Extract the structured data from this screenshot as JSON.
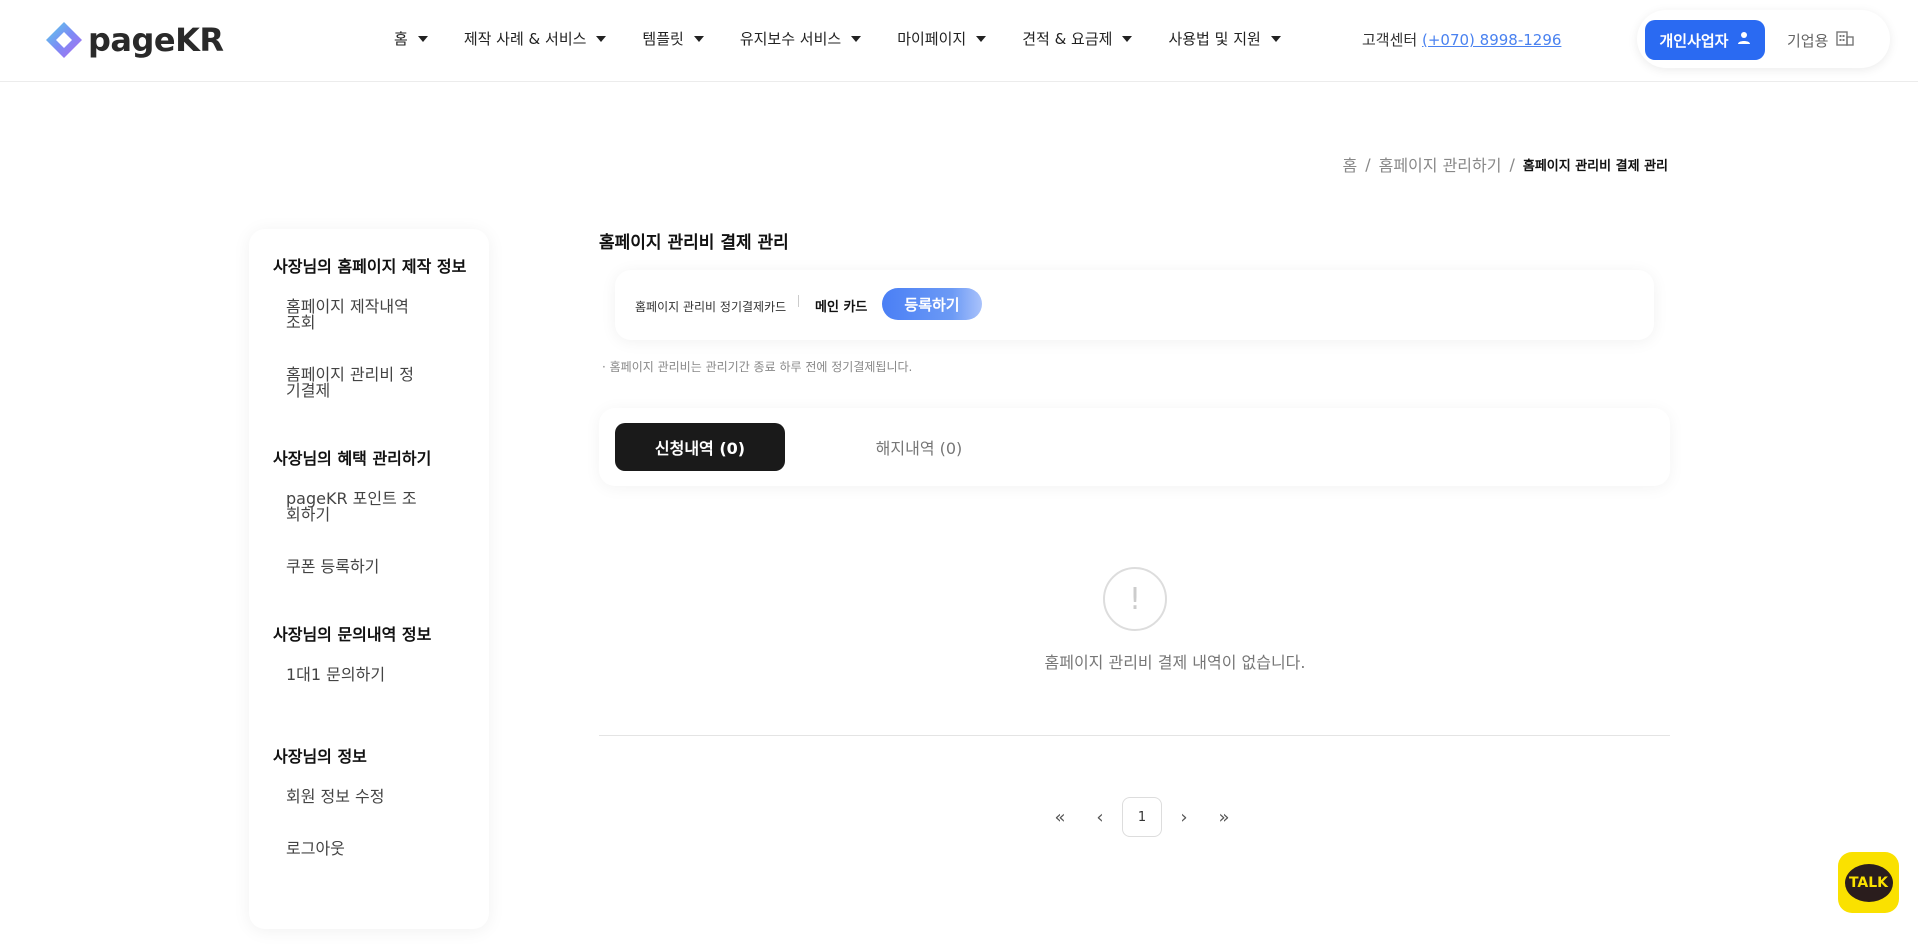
{
  "header": {
    "logo_text": "pageKR",
    "nav": [
      {
        "label": "홈"
      },
      {
        "label": "제작 사례 & 서비스"
      },
      {
        "label": "템플릿"
      },
      {
        "label": "유지보수 서비스"
      },
      {
        "label": "마이페이지"
      },
      {
        "label": "견적 & 요금제"
      },
      {
        "label": "사용법 및 지원"
      }
    ],
    "cs_label": "고객센터",
    "cs_phone": "(+070) 8998-1296",
    "personal_label": "개인사업자",
    "corp_label": "기업용",
    "accent_color": "#2a6af2"
  },
  "breadcrumb": {
    "home": "홈",
    "parent": "홈페이지 관리하기",
    "current": "홈페이지 관리비 결제 관리"
  },
  "sidebar": {
    "groups": [
      {
        "title": "사장님의 홈페이지 제작 정보",
        "items": [
          "홈페이지 제작내역 조회",
          "홈페이지 관리비 정기결제"
        ]
      },
      {
        "title": "사장님의 혜택 관리하기",
        "items": [
          "pageKR 포인트 조회하기",
          "쿠폰 등록하기"
        ]
      },
      {
        "title": "사장님의 문의내역 정보",
        "items": [
          "1대1 문의하기"
        ]
      },
      {
        "title": "사장님의 정보",
        "items": [
          "회원 정보 수정",
          "로그아웃"
        ]
      }
    ]
  },
  "main": {
    "title": "홈페이지 관리비 결제 관리",
    "card_label": "홈페이지 관리비 정기결제카드",
    "card_main_label": "메인 카드",
    "register_label": "등록하기",
    "note": "· 홈페이지 관리비는 관리기간 종료 하루 전에 정기결제됩니다.",
    "tab_active": "신청내역 (0)",
    "tab_inactive": "해지내역 (0)",
    "empty_text": "홈페이지 관리비 결제 내역이 없습니다.",
    "current_page": "1"
  },
  "icons": {
    "user": "user-icon",
    "building": "building-icon",
    "empty": "exclamation-icon",
    "chat": "kakaotalk-icon"
  },
  "talk_label": "TALK"
}
